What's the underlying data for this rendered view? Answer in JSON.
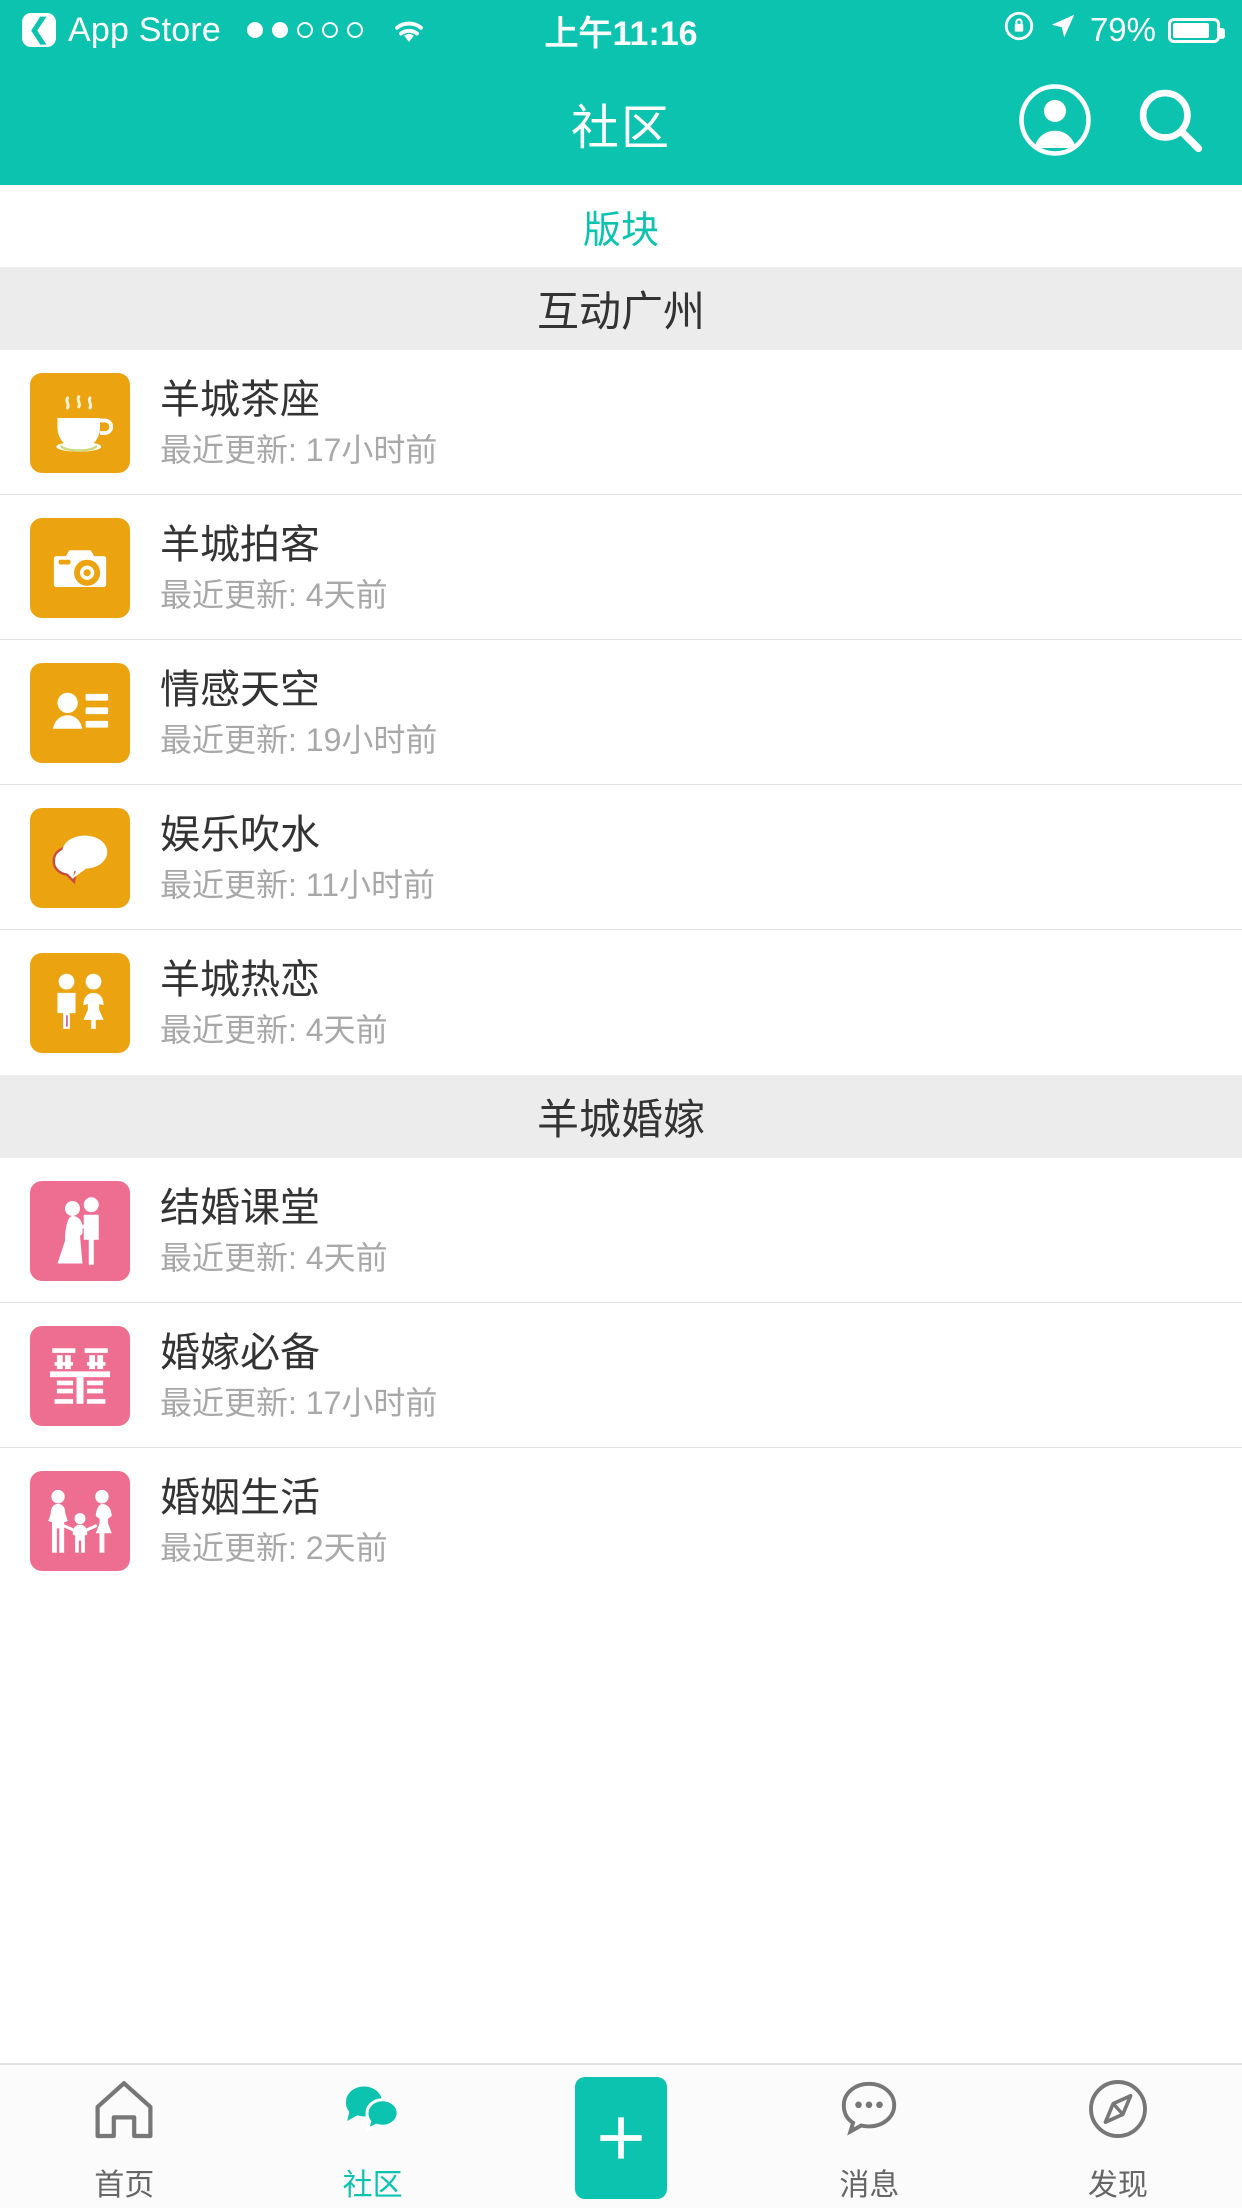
{
  "statusbar": {
    "back_label": "App Store",
    "back_icon": "chevron-left-icon",
    "signal_dots_filled": 2,
    "signal_dots_total": 5,
    "wifi_icon": "wifi-icon",
    "time": "上午11:16",
    "rotation_lock_icon": "rotation-lock-icon",
    "location_icon": "location-arrow-icon",
    "battery_percent": "79%",
    "battery_icon": "battery-icon",
    "bg_color": "#0CC3B0"
  },
  "navbar": {
    "title": "社区",
    "avatar_icon": "avatar-icon",
    "search_icon": "search-icon"
  },
  "tabstrip": {
    "tabs": [
      {
        "label": "版块",
        "active": true
      }
    ],
    "accent_color": "#0CC3B0"
  },
  "sections": [
    {
      "title": "互动广州",
      "items": [
        {
          "name": "羊城茶座",
          "update": "最近更新: 17小时前",
          "icon": "teacup-icon",
          "tile": "tile-orange"
        },
        {
          "name": "羊城拍客",
          "update": "最近更新: 4天前",
          "icon": "camera-icon",
          "tile": "tile-orange"
        },
        {
          "name": "情感天空",
          "update": "最近更新: 19小时前",
          "icon": "contact-card-icon",
          "tile": "tile-orange"
        },
        {
          "name": "娱乐吹水",
          "update": "最近更新: 11小时前",
          "icon": "chat-bubbles-icon",
          "tile": "tile-orange"
        },
        {
          "name": "羊城热恋",
          "update": "最近更新: 4天前",
          "icon": "couple-icon",
          "tile": "tile-orange"
        }
      ]
    },
    {
      "title": "羊城婚嫁",
      "items": [
        {
          "name": "结婚课堂",
          "update": "最近更新: 4天前",
          "icon": "bride-groom-icon",
          "tile": "tile-pink"
        },
        {
          "name": "婚嫁必备",
          "update": "最近更新: 17小时前",
          "icon": "double-happiness-icon",
          "tile": "tile-pink"
        },
        {
          "name": "婚姻生活",
          "update": "最近更新: 2天前",
          "icon": "family-icon",
          "tile": "tile-pink"
        }
      ]
    }
  ],
  "tabbar": {
    "items": [
      {
        "label": "首页",
        "icon": "home-icon",
        "active": false
      },
      {
        "label": "社区",
        "icon": "community-icon",
        "active": true
      },
      {
        "label": "",
        "icon": "plus-icon",
        "active": false
      },
      {
        "label": "消息",
        "icon": "message-icon",
        "active": false
      },
      {
        "label": "发现",
        "icon": "compass-icon",
        "active": false
      }
    ],
    "accent_color": "#0CC3B0"
  }
}
